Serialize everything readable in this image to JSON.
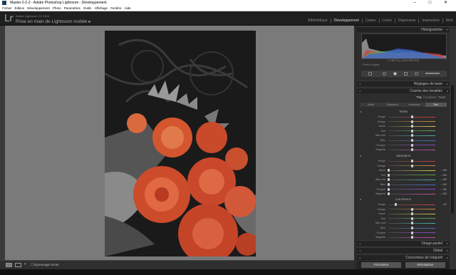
{
  "window": {
    "title": "Master-2-2-2 - Adobe Photoshop Lightroom - Développement",
    "controls": [
      "–",
      "□",
      "✕"
    ]
  },
  "menu": [
    "Fichier",
    "Édition",
    "Développement",
    "Photo",
    "Paramètres",
    "Outils",
    "Affichage",
    "Fenêtre",
    "Aide"
  ],
  "identity": {
    "logo": "Lr",
    "catalog": "Adobe Lightroom CC 2015",
    "title": "Prise en main de Lightroom mobile",
    "arrow": "▸"
  },
  "modules": [
    {
      "label": "Bibliothèque",
      "active": false
    },
    {
      "label": "Développement",
      "active": true
    },
    {
      "label": "Cartes",
      "active": false
    },
    {
      "label": "Livres",
      "active": false
    },
    {
      "label": "Diaporama",
      "active": false
    },
    {
      "label": "Impression",
      "active": false
    },
    {
      "label": "Web",
      "active": false
    }
  ],
  "histogram": {
    "title": "Histogramme",
    "info": "f / ISO   ⅟₁₆₀   f/4,0   ISO 100",
    "original": "Photo d'origine"
  },
  "panels": {
    "basic": "Réglages de base",
    "tone_curve": "Courbe des tonalités",
    "split": "Virage partiel",
    "detail": "Détail",
    "lens": "Corrections de l'objectif"
  },
  "hsl": {
    "tabs": [
      "TSL",
      "/",
      "Couleur",
      "/",
      "N&B"
    ],
    "active_tab": "TSL",
    "subtabs": [
      "Teinte",
      "Saturation",
      "Luminance",
      "Tout"
    ],
    "active_subtab": "Tout"
  },
  "groups": [
    {
      "title": "Teinte",
      "rows": [
        {
          "label": "Rouge",
          "value": "",
          "pos": 0.5
        },
        {
          "label": "Orange",
          "value": "",
          "pos": 0.5
        },
        {
          "label": "Jaune",
          "value": "",
          "pos": 0.5
        },
        {
          "label": "Vert",
          "value": "",
          "pos": 0.5
        },
        {
          "label": "Bleu vert",
          "value": "",
          "pos": 0.5
        },
        {
          "label": "Bleu",
          "value": "",
          "pos": 0.5
        },
        {
          "label": "Pourpre",
          "value": "",
          "pos": 0.5
        },
        {
          "label": "Magenta",
          "value": "",
          "pos": 0.5
        }
      ]
    },
    {
      "title": "Saturation",
      "rows": [
        {
          "label": "Rouge",
          "value": "",
          "pos": 0.5
        },
        {
          "label": "Orange",
          "value": "",
          "pos": 0.5
        },
        {
          "label": "Jaune",
          "value": "– 100",
          "pos": 0.0
        },
        {
          "label": "Vert",
          "value": "– 100",
          "pos": 0.0
        },
        {
          "label": "Bleu vert",
          "value": "– 100",
          "pos": 0.0
        },
        {
          "label": "Bleu",
          "value": "– 100",
          "pos": 0.0
        },
        {
          "label": "Pourpre",
          "value": "– 100",
          "pos": 0.0
        },
        {
          "label": "Magenta",
          "value": "– 100",
          "pos": 0.0
        }
      ]
    },
    {
      "title": "Luminance",
      "rows": [
        {
          "label": "Rouge",
          "value": "– 67",
          "pos": 0.16
        },
        {
          "label": "Orange",
          "value": "",
          "pos": 0.5
        },
        {
          "label": "Jaune",
          "value": "",
          "pos": 0.5
        },
        {
          "label": "Vert",
          "value": "",
          "pos": 0.5
        },
        {
          "label": "Bleu vert",
          "value": "",
          "pos": 0.5
        },
        {
          "label": "Bleu",
          "value": "",
          "pos": 0.5
        },
        {
          "label": "Pourpre",
          "value": "",
          "pos": 0.5
        },
        {
          "label": "Magenta",
          "value": "",
          "pos": 0.5
        }
      ]
    }
  ],
  "colors": {
    "Rouge": "#d04040",
    "Orange": "#d88a3a",
    "Jaune": "#d8c84a",
    "Vert": "#5aa84a",
    "Bleu vert": "#4ab0a8",
    "Bleu": "#4a70c8",
    "Pourpre": "#8a4ac8",
    "Magenta": "#c84aa8"
  },
  "buttons": {
    "previous": "Précédent",
    "reset": "Réinitialiser"
  },
  "toolbar": {
    "softproof_label": "Épreuvage écran"
  }
}
